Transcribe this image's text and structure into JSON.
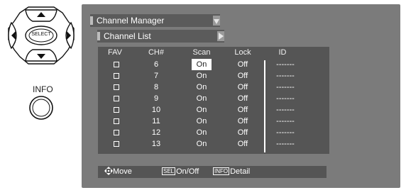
{
  "remote": {
    "select_label": "SELECT",
    "info_label": "INFO"
  },
  "menu": {
    "breadcrumb_1": "Channel Manager",
    "breadcrumb_2": "Channel List"
  },
  "table": {
    "headers": [
      "FAV",
      "CH#",
      "Scan",
      "Lock",
      "ID"
    ],
    "rows": [
      {
        "ch": "6",
        "scan": "On",
        "lock": "Off",
        "id": "-------",
        "selected": true
      },
      {
        "ch": "7",
        "scan": "On",
        "lock": "Off",
        "id": "-------"
      },
      {
        "ch": "8",
        "scan": "On",
        "lock": "Off",
        "id": "-------"
      },
      {
        "ch": "9",
        "scan": "On",
        "lock": "Off",
        "id": "-------"
      },
      {
        "ch": "10",
        "scan": "On",
        "lock": "Off",
        "id": "-------"
      },
      {
        "ch": "11",
        "scan": "On",
        "lock": "Off",
        "id": "-------"
      },
      {
        "ch": "12",
        "scan": "On",
        "lock": "Off",
        "id": "-------"
      },
      {
        "ch": "13",
        "scan": "On",
        "lock": "Off",
        "id": "-------"
      }
    ]
  },
  "footer": {
    "move_label": "Move",
    "sel_key": "SEL",
    "onoff_label": "On/Off",
    "info_key": "INFO",
    "detail_label": "Detail"
  },
  "colors": {
    "panel_bg": "#7b7b7b",
    "list_bg": "#555555",
    "highlight": "#ffffff"
  }
}
